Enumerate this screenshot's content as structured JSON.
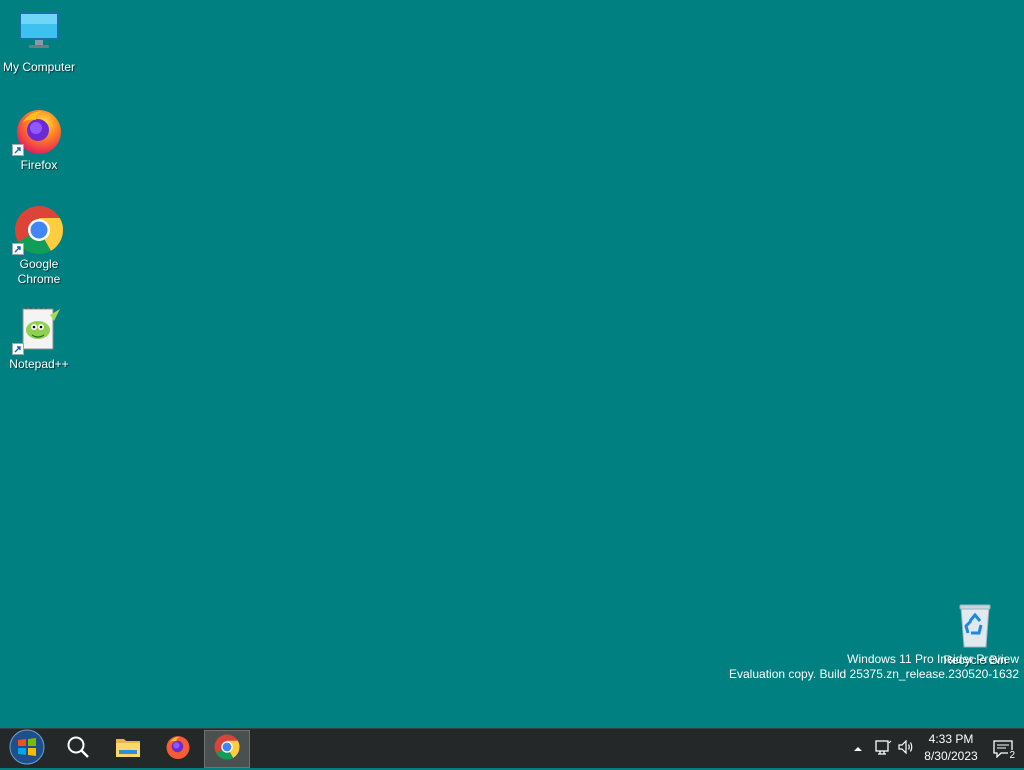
{
  "desktop": {
    "background_color": "#008080",
    "icons": [
      {
        "label": "My Computer",
        "icon": "monitor-icon"
      },
      {
        "label": "Firefox",
        "icon": "firefox-icon"
      },
      {
        "label": "Google Chrome",
        "icon": "chrome-icon"
      },
      {
        "label": "Notepad++",
        "icon": "notepadpp-icon"
      },
      {
        "label": "Recycle Bin",
        "icon": "recycle-bin-icon"
      }
    ],
    "watermark": {
      "line1": "Windows 11 Pro Insider Preview",
      "line2": "Evaluation copy. Build 25375.zn_release.230520-1632"
    }
  },
  "taskbar": {
    "items": [
      {
        "icon": "start-orb-icon"
      },
      {
        "icon": "search-icon"
      },
      {
        "icon": "file-explorer-icon"
      },
      {
        "icon": "firefox-icon"
      },
      {
        "icon": "chrome-icon",
        "active": true
      }
    ],
    "tray": {
      "time": "4:33 PM",
      "date": "8/30/2023",
      "notification_count": "2"
    }
  }
}
